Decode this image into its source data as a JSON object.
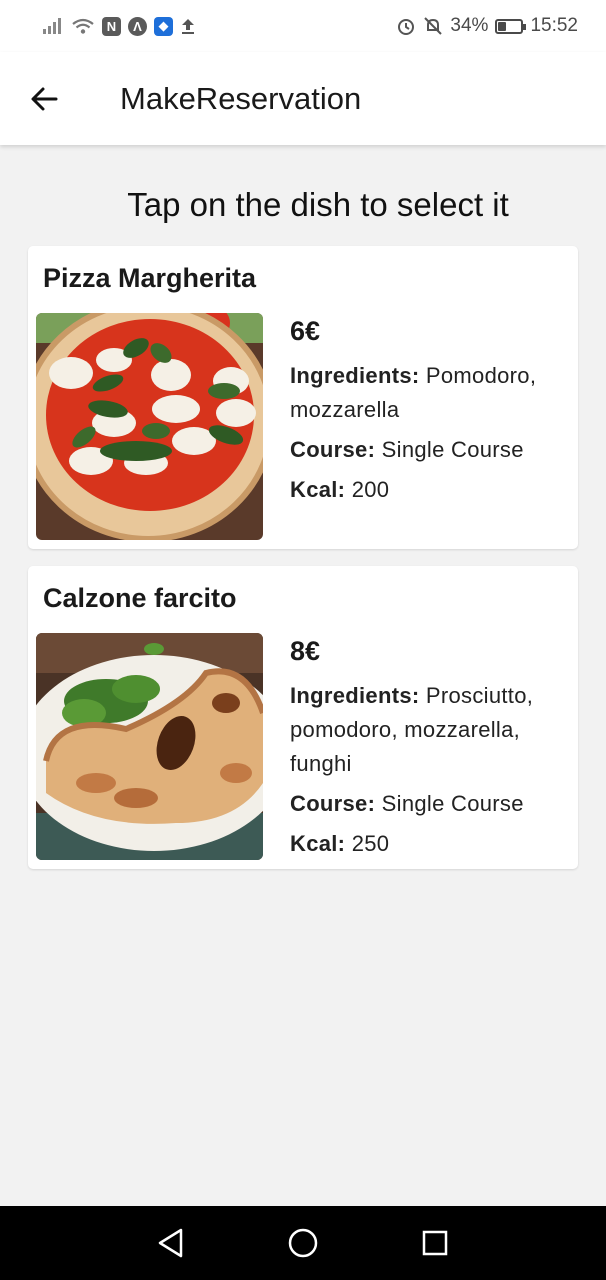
{
  "status_bar": {
    "battery": "34%",
    "time": "15:52"
  },
  "app_bar": {
    "title": "MakeReservation"
  },
  "instruction": "Tap on the dish to select it",
  "labels": {
    "ingredients": "Ingredients:",
    "course": "Course:",
    "kcal": "Kcal:"
  },
  "dishes": [
    {
      "name": "Pizza Margherita",
      "price": "6€",
      "ingredients": "Pomodoro, mozzarella",
      "course": "Single Course",
      "kcal": "200"
    },
    {
      "name": "Calzone farcito",
      "price": "8€",
      "ingredients": "Prosciutto, pomodoro, mozzarella, funghi",
      "course": "Single Course",
      "kcal": "250"
    }
  ],
  "colors": {
    "background": "#f2f2f2",
    "surface": "#ffffff",
    "text": "#1a1a1a",
    "nav_bar": "#000000"
  },
  "icons": [
    "signal-icon",
    "wifi-icon",
    "nfc-icon",
    "app-icon",
    "shield-icon",
    "upload-icon",
    "alarm-icon",
    "mute-icon",
    "battery-icon",
    "back-arrow-icon",
    "nav-back-icon",
    "nav-home-icon",
    "nav-recents-icon"
  ]
}
